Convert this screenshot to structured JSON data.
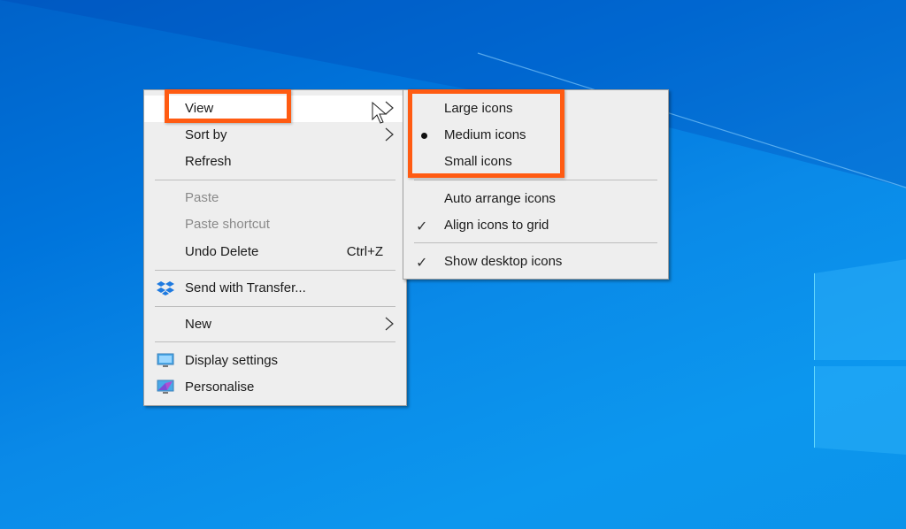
{
  "desktop": {
    "background_color": "#0a84e2"
  },
  "context_menu": {
    "items": [
      {
        "label": "View",
        "has_submenu": true,
        "state": "hover"
      },
      {
        "label": "Sort by",
        "has_submenu": true
      },
      {
        "label": "Refresh"
      },
      {
        "label": "Paste",
        "disabled": true
      },
      {
        "label": "Paste shortcut",
        "disabled": true
      },
      {
        "label": "Undo Delete",
        "shortcut": "Ctrl+Z"
      },
      {
        "label": "Send with Transfer...",
        "icon": "dropbox-icon"
      },
      {
        "label": "New",
        "has_submenu": true
      },
      {
        "label": "Display settings",
        "icon": "display-icon"
      },
      {
        "label": "Personalise",
        "icon": "personalise-icon"
      }
    ]
  },
  "view_submenu": {
    "items": [
      {
        "label": "Large icons"
      },
      {
        "label": "Medium icons",
        "selected": true
      },
      {
        "label": "Small icons"
      },
      {
        "label": "Auto arrange icons"
      },
      {
        "label": "Align icons to grid",
        "checked": true
      },
      {
        "label": "Show desktop icons",
        "checked": true
      }
    ],
    "check_glyph": "✓"
  },
  "annotation": {
    "highlight_color": "#ff5b12"
  }
}
